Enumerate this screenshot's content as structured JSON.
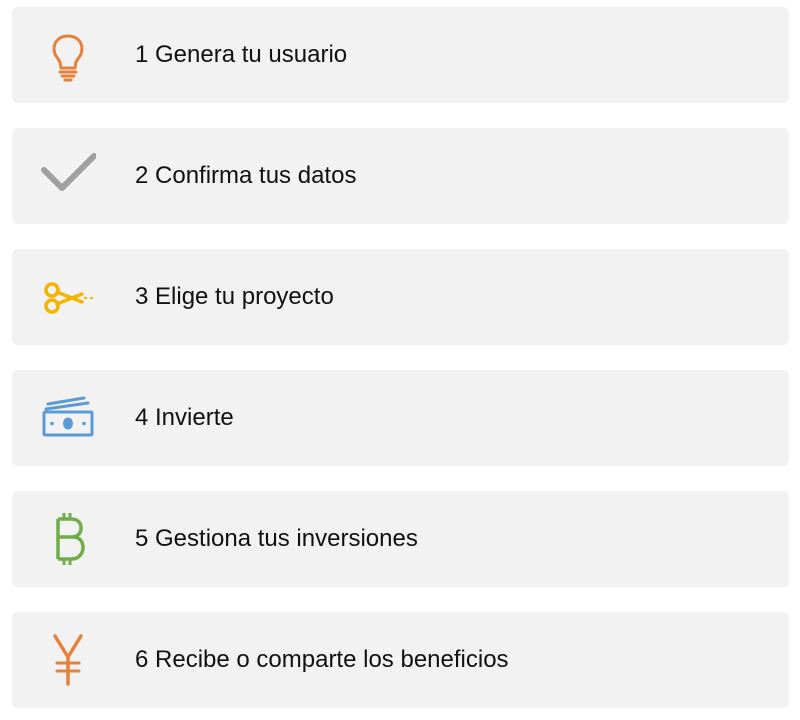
{
  "steps": [
    {
      "label": "1 Genera tu usuario",
      "icon": "lightbulb-icon",
      "color": "#e6813a"
    },
    {
      "label": "2 Confirma tus datos",
      "icon": "checkmark-icon",
      "color": "#a0a0a0"
    },
    {
      "label": "3 Elige tu proyecto",
      "icon": "scissors-icon",
      "color": "#f4b400"
    },
    {
      "label": "4 Invierte",
      "icon": "money-icon",
      "color": "#5b9bd5"
    },
    {
      "label": "5 Gestiona tus inversiones",
      "icon": "bitcoin-icon",
      "color": "#70ad47"
    },
    {
      "label": "6 Recibe o comparte los beneficios",
      "icon": "yen-icon",
      "color": "#e6813a"
    }
  ]
}
